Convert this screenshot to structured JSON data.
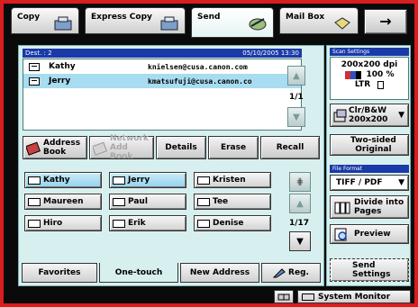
{
  "tabs": [
    {
      "label": "Copy"
    },
    {
      "label": "Express Copy"
    },
    {
      "label": "Send"
    },
    {
      "label": "Mail Box"
    }
  ],
  "next_arrow": "→",
  "destination": {
    "header_label": "Dest. : 2",
    "timestamp": "05/10/2005 13:30",
    "rows": [
      {
        "name": "Kathy",
        "email": "knielsen@cusa.canon.com"
      },
      {
        "name": "Jerry",
        "email": "kmatsufuji@cusa.canon.co"
      }
    ],
    "page": "1/1"
  },
  "functions": {
    "address_book": "Address\nBook",
    "network_address_book": "Network\nAdd Book",
    "details": "Details",
    "erase": "Erase",
    "recall": "Recall"
  },
  "onetouch": {
    "buttons": [
      "Kathy",
      "Jerry",
      "Kristen",
      "Maureen",
      "Paul",
      "Tee",
      "Hiro",
      "Erik",
      "Denise"
    ],
    "page": "1/17"
  },
  "bottom_tabs": {
    "favorites": "Favorites",
    "onetouch": "One-touch",
    "new_address": "New Address",
    "reg": "Reg."
  },
  "scan_settings": {
    "header": "Scan Settings",
    "resolution": "200x200 dpi",
    "zoom": "100 %",
    "paper": "LTR",
    "mode": "Clr/B&W",
    "mode_res": "200x200",
    "two_sided": "Two-sided\nOriginal"
  },
  "file_format": {
    "header": "File Format",
    "value": "TIFF / PDF",
    "divide": "Divide into\nPages",
    "preview": "Preview",
    "send_settings": "Send\nSettings"
  },
  "system_monitor": "System Monitor"
}
